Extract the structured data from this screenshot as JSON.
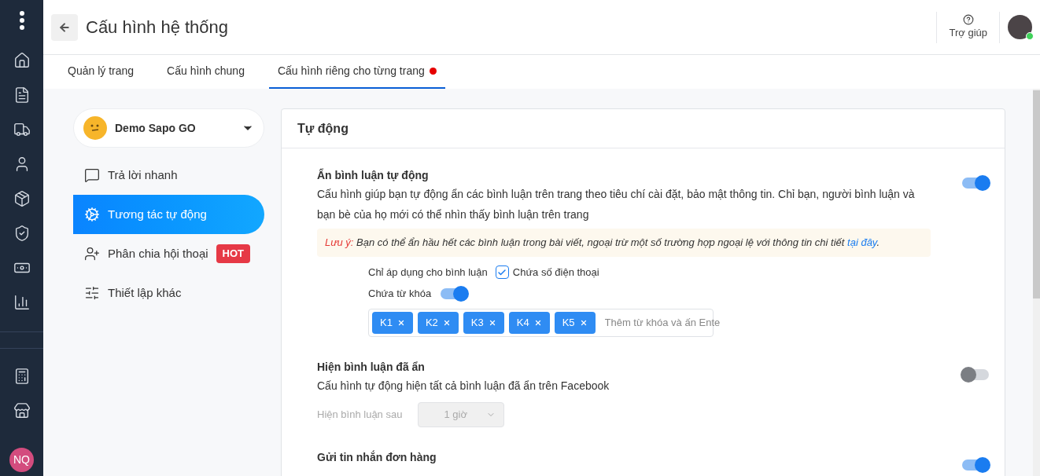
{
  "header": {
    "title": "Cấu hình hệ thống",
    "help": "Trợ giúp",
    "avatar_online": true
  },
  "rail": {
    "user_initials": "NQ"
  },
  "tabs": [
    {
      "label": "Quản lý trang",
      "selected": false,
      "dot": false
    },
    {
      "label": "Cấu hình chung",
      "selected": false,
      "dot": false
    },
    {
      "label": "Cấu hình riêng cho từng trang",
      "selected": true,
      "dot": true
    }
  ],
  "page_selector": {
    "value": "Demo Sapo GO"
  },
  "menu": [
    {
      "label": "Trả lời nhanh",
      "selected": false
    },
    {
      "label": "Tương tác tự động",
      "selected": true
    },
    {
      "label": "Phân chia hội thoại",
      "selected": false,
      "badge": "HOT"
    },
    {
      "label": "Thiết lập khác",
      "selected": false
    }
  ],
  "card": {
    "title": "Tự động",
    "sections": [
      {
        "kind": "hide",
        "title": "Ẩn bình luận tự động",
        "on": true,
        "description": "Cấu hình giúp bạn tự động ẩn các bình luận trên trang theo tiêu chí cài đặt, bảo mật thông tin. Chỉ bạn, người bình luận và bạn bè của họ mới có thể nhìn thấy bình luận trên trang",
        "note": {
          "label": "Lưu ý:",
          "text": "Bạn có thể ẩn hầu hết các bình luận trong bài viết, ngoại trừ một số trường hợp ngoại lệ với thông tin chi tiết",
          "link": "tại đây",
          "end": "."
        },
        "apply_label": "Chỉ áp dụng cho bình luận",
        "phone": {
          "label": "Chứa số điện thoại",
          "checked": true
        },
        "keyword": {
          "label": "Chứa từ khóa",
          "on": true
        },
        "tags": [
          "K1",
          "K2",
          "K3",
          "K4",
          "K5"
        ],
        "tag_placeholder": "Thêm từ khóa và ấn Ente"
      },
      {
        "kind": "show",
        "title": "Hiện bình luận đã ẩn",
        "on": false,
        "description": "Cấu hình tự động hiện tất cả bình luận đã ẩn trên Facebook",
        "delay_label": "Hiện bình luận sau",
        "delay_value": "1 giờ",
        "disabled": true
      },
      {
        "kind": "plain",
        "title": "Gửi tin nhắn đơn hàng",
        "on": true
      }
    ]
  }
}
